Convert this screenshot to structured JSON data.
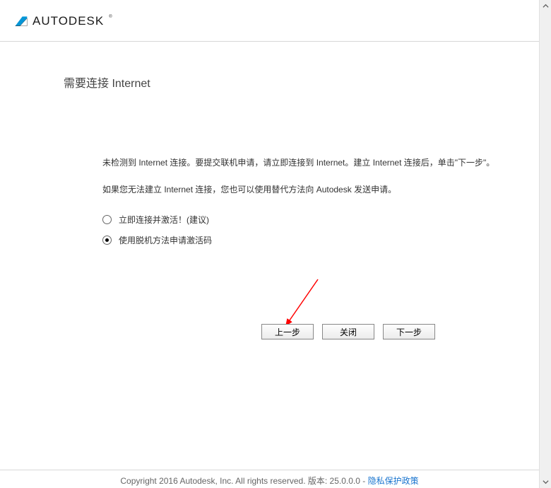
{
  "brand": "AUTODESK",
  "title": "需要连接 Internet",
  "paragraph1": "未检测到 Internet 连接。要提交联机申请，请立即连接到 Internet。建立 Internet 连接后，单击\"下一步\"。",
  "paragraph2": "如果您无法建立 Internet 连接，您也可以使用替代方法向 Autodesk 发送申请。",
  "options": {
    "connect": "立即连接并激活！(建议)",
    "offline": "使用脱机方法申请激活码"
  },
  "buttons": {
    "back": "上一步",
    "close": "关闭",
    "next": "下一步"
  },
  "footer": {
    "copyright": "Copyright 2016 Autodesk, Inc. All rights reserved. 版本: 25.0.0.0 - ",
    "privacy": "隐私保护政策"
  }
}
